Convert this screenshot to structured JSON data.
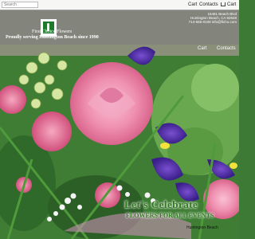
{
  "topbar": {
    "search_placeholder": "Search",
    "cart_label": "Cart",
    "contacts_label": "Contacts",
    "cart_link_label": "Cart"
  },
  "header": {
    "shop_name": "First Choice Flowers",
    "tagline": "Proudly serving Huntington Beach since 1990",
    "address_line1": "15481 Beach Blvd",
    "address_line2": "Huntington Beach, CA 92648",
    "address_line3": "714-555-0108 info@ficho.com"
  },
  "nav": {
    "cart_label": "Cart",
    "contacts_label": "Contacts"
  },
  "banner": {
    "line1": "Let's Celebrate",
    "line2": "FLOWERS FOR ALL EVENTS",
    "line3": "Huntington Beach"
  },
  "colors": {
    "brand_green": "#1f7a2e",
    "headline_green": "#2f7a1b",
    "header_overlay": "#7d7d7d"
  }
}
